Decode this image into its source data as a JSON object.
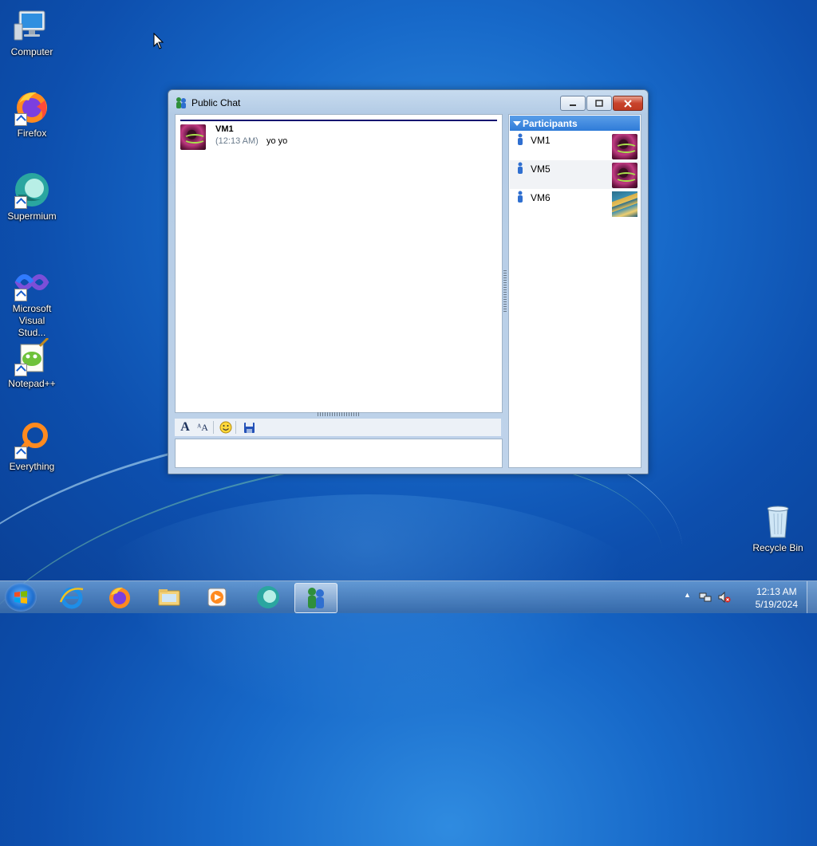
{
  "desktop": {
    "icons": [
      {
        "label": "Computer",
        "icon": "computer-icon"
      },
      {
        "label": "Firefox",
        "icon": "firefox-icon"
      },
      {
        "label": "Supermium",
        "icon": "supermium-icon"
      },
      {
        "label": "Microsoft Visual Stud...",
        "icon": "visual-studio-icon"
      },
      {
        "label": "Notepad++",
        "icon": "notepadpp-icon"
      },
      {
        "label": "Everything",
        "icon": "everything-icon"
      },
      {
        "label": "Recycle Bin",
        "icon": "recycle-bin-icon"
      }
    ]
  },
  "window": {
    "title": "Public Chat",
    "chat": {
      "messages": [
        {
          "sender": "VM1",
          "time": "(12:13 AM)",
          "text": "yo yo"
        }
      ]
    },
    "participants": {
      "header": "Participants",
      "items": [
        {
          "name": "VM1",
          "avatar": "purple-ball-avatar"
        },
        {
          "name": "VM5",
          "avatar": "purple-ball-avatar"
        },
        {
          "name": "VM6",
          "avatar": "stairs-avatar"
        }
      ]
    },
    "toolbar": {
      "font_glyph": "A",
      "font_size_glyph": "ᴬA",
      "smiley_glyph": "☺"
    },
    "input": {
      "value": ""
    }
  },
  "taskbar": {
    "apps": [
      "internet-explorer-icon",
      "firefox-icon",
      "file-explorer-icon",
      "media-player-icon",
      "supermium-icon",
      "chat-messenger-icon"
    ],
    "clock": {
      "time": "12:13 AM",
      "date": "5/19/2024"
    },
    "tray_arrow": "▲"
  }
}
